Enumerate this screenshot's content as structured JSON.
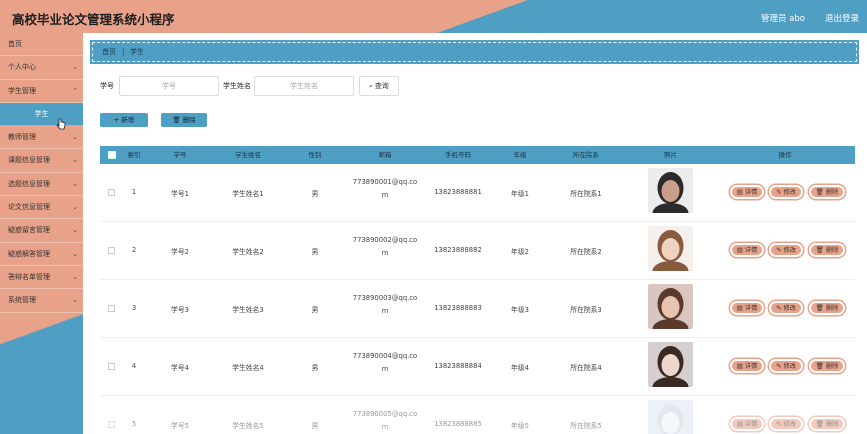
{
  "header": {
    "title": "高校毕业论文管理系统小程序",
    "user": "管理员 abo",
    "logout": "退出登录"
  },
  "sidebar": {
    "items": [
      {
        "label": "首页",
        "chevron": false
      },
      {
        "label": "个人中心",
        "chevron": true
      },
      {
        "label": "学生管理",
        "chevron": true
      },
      {
        "label": "学生",
        "chevron": false,
        "sub": true
      },
      {
        "label": "教师管理",
        "chevron": true
      },
      {
        "label": "课题信息管理",
        "chevron": true
      },
      {
        "label": "选题信息管理",
        "chevron": true
      },
      {
        "label": "论文信息管理",
        "chevron": true
      },
      {
        "label": "疑惑留言管理",
        "chevron": true
      },
      {
        "label": "疑惑解答管理",
        "chevron": true
      },
      {
        "label": "答辩名单管理",
        "chevron": true
      },
      {
        "label": "系统管理",
        "chevron": true
      }
    ]
  },
  "breadcrumb": {
    "home": "首页",
    "sep": "|",
    "current": "学生"
  },
  "search": {
    "id_label": "学号",
    "id_placeholder": "学号",
    "name_label": "学生姓名",
    "name_placeholder": "学生姓名",
    "query_button": "查询"
  },
  "actions": {
    "add": "新增",
    "delete": "删除"
  },
  "table": {
    "headers": [
      "索引",
      "学号",
      "学生姓名",
      "性别",
      "邮箱",
      "手机号码",
      "年级",
      "所在院系",
      "照片",
      "操作"
    ],
    "rows": [
      {
        "index": "1",
        "id": "学号1",
        "name": "学生姓名1",
        "gender": "男",
        "email1": "773890001@qq.co",
        "email2": "m",
        "phone": "13823888881",
        "grade": "年级1",
        "dept": "所在院系1"
      },
      {
        "index": "2",
        "id": "学号2",
        "name": "学生姓名2",
        "gender": "男",
        "email1": "773890002@qq.co",
        "email2": "m",
        "phone": "13823888882",
        "grade": "年级2",
        "dept": "所在院系2"
      },
      {
        "index": "3",
        "id": "学号3",
        "name": "学生姓名3",
        "gender": "男",
        "email1": "773890003@qq.co",
        "email2": "m",
        "phone": "13823888883",
        "grade": "年级3",
        "dept": "所在院系3"
      },
      {
        "index": "4",
        "id": "学号4",
        "name": "学生姓名4",
        "gender": "男",
        "email1": "773890004@qq.co",
        "email2": "m",
        "phone": "13823888884",
        "grade": "年级4",
        "dept": "所在院系4"
      },
      {
        "index": "5",
        "id": "学号5",
        "name": "学生姓名5",
        "gender": "男",
        "email1": "773890005@qq.co",
        "email2": "m",
        "phone": "13823888885",
        "grade": "年级5",
        "dept": "所在院系5"
      }
    ],
    "ops": {
      "detail": "详情",
      "edit": "修改",
      "delete": "删除"
    }
  },
  "colors": {
    "accent_blue": "#4f9ec4",
    "accent_salmon": "#e9a28a"
  }
}
